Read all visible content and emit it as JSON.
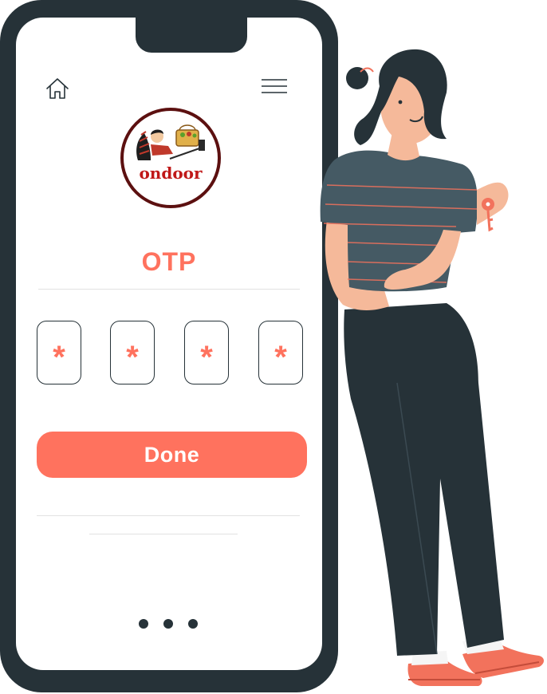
{
  "screen": {
    "title": "OTP",
    "logo_text": "ondoor",
    "otp_digits": [
      "*",
      "*",
      "*",
      "*"
    ],
    "done_label": "Done",
    "page_indicator_count": 3
  },
  "colors": {
    "accent": "#ff725e",
    "phone_frame": "#263238",
    "logo_text": "#c01818",
    "logo_border": "#5c1010"
  },
  "icons": {
    "home": "home-icon",
    "menu": "hamburger-menu-icon"
  }
}
